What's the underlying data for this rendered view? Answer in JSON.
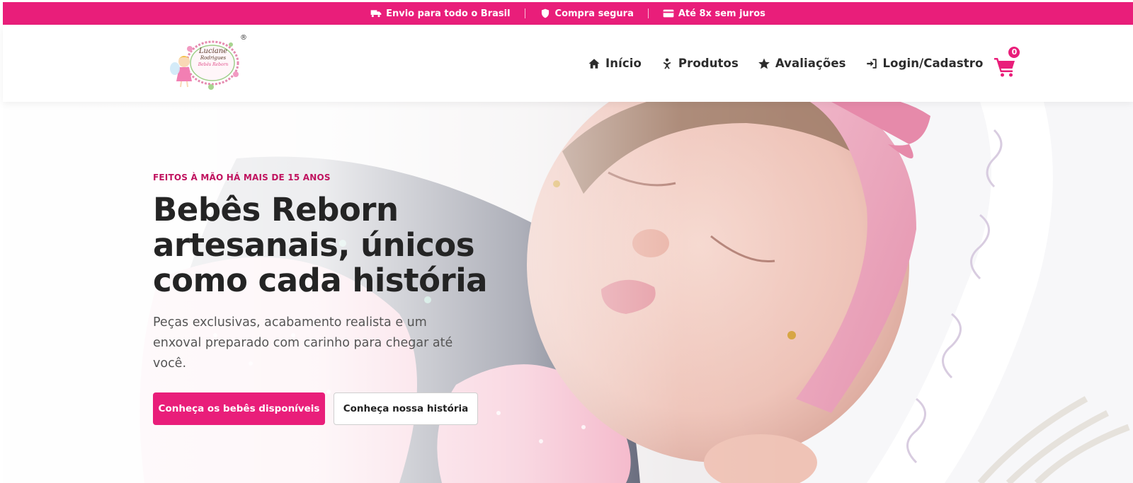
{
  "topbar": {
    "items": [
      {
        "icon": "truck-icon",
        "label": "Envio para todo o Brasil"
      },
      {
        "icon": "shield-icon",
        "label": "Compra segura"
      },
      {
        "icon": "credit-card-icon",
        "label": "Até 8x sem juros"
      }
    ]
  },
  "header": {
    "logo": {
      "line1": "Luciane",
      "line2": "Rodrigues",
      "line3": "Bebês Reborn",
      "mark": "®"
    },
    "nav": [
      {
        "icon": "home-icon",
        "label": "Início"
      },
      {
        "icon": "baby-icon",
        "label": "Produtos"
      },
      {
        "icon": "star-icon",
        "label": "Avaliações"
      },
      {
        "icon": "login-icon",
        "label": "Login/Cadastro"
      }
    ],
    "cart": {
      "count": "0"
    }
  },
  "hero": {
    "eyebrow": "FEITOS À MÃO HÁ MAIS DE 15 ANOS",
    "headline_line1": "Bebês Reborn",
    "headline_line2": "artesanais, únicos",
    "headline_line3": "como cada história",
    "subtitle": "Peças exclusivas, acabamento realista e um enxoval preparado com carinho para chegar até você.",
    "primary_button": "Conheça os bebês disponíveis",
    "secondary_button": "Conheça nossa história"
  },
  "colors": {
    "brand": "#e91e7a",
    "eyebrow": "#c0135f",
    "text": "#242424"
  }
}
